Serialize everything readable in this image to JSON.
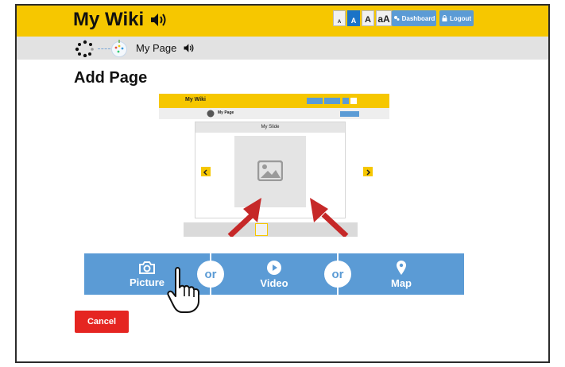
{
  "header": {
    "title": "My Wiki",
    "text_size_buttons": [
      "A",
      "A",
      "A",
      "aA"
    ],
    "active_text_size_index": 1,
    "dashboard_label": "Dashboard",
    "logout_label": "Logout",
    "brand_color": "#f6c700",
    "accent_color": "#5b9bd5"
  },
  "breadcrumb": {
    "page_title": "My Page"
  },
  "main": {
    "heading": "Add Page"
  },
  "preview": {
    "site_title": "My Wiki",
    "page_title": "My Page",
    "slide_title": "My Slide"
  },
  "choices": {
    "picture_label": "Picture",
    "video_label": "Video",
    "map_label": "Map",
    "or_text": "or"
  },
  "footer": {
    "cancel_label": "Cancel",
    "cancel_color": "#e52521"
  }
}
